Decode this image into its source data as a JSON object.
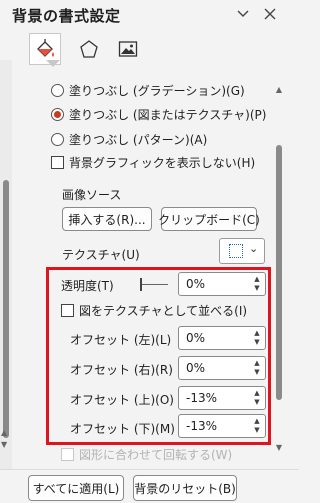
{
  "header": {
    "title": "背景の書式設定",
    "collapse_symbol": "⌄",
    "close_symbol": "✕"
  },
  "categories": [
    {
      "name": "fill",
      "icon": "paint-bucket-icon",
      "active": true
    },
    {
      "name": "effects",
      "icon": "pentagon-icon",
      "active": false
    },
    {
      "name": "picture",
      "icon": "picture-icon",
      "active": false
    }
  ],
  "fill": {
    "gradient_label": "塗りつぶし (グラデーション)(G)",
    "picture_label": "塗りつぶし (図またはテクスチャ)(P)",
    "pattern_label": "塗りつぶし (パターン)(A)",
    "hide_graphics_label": "背景グラフィックを表示しない(H)",
    "selected": "picture"
  },
  "image_source": {
    "label": "画像ソース",
    "insert_button": "挿入する(R)...",
    "clipboard_button": "クリップボード(C)"
  },
  "texture": {
    "label": "テクスチャ(U)",
    "caret": "⌄"
  },
  "transparency": {
    "label": "透明度(T)",
    "value": "0%",
    "fraction": 0
  },
  "tile_checkbox": {
    "label": "図をテクスチャとして並べる(I)",
    "checked": false
  },
  "offsets": [
    {
      "label": "オフセット (左)(L)",
      "value": "0%"
    },
    {
      "label": "オフセット (右)(R)",
      "value": "0%"
    },
    {
      "label": "オフセット (上)(O)",
      "value": "-13%"
    },
    {
      "label": "オフセット (下)(M)",
      "value": "-13%"
    }
  ],
  "rotate_checkbox": {
    "label": "図形に合わせて回転する(W)",
    "enabled": false
  },
  "footer": {
    "apply_all": "すべてに適用(L)",
    "reset": "背景のリセット(B)"
  },
  "colors": {
    "accent": "#c43e1c",
    "highlight_frame": "#e0141e",
    "background": "#f3f3f3"
  }
}
